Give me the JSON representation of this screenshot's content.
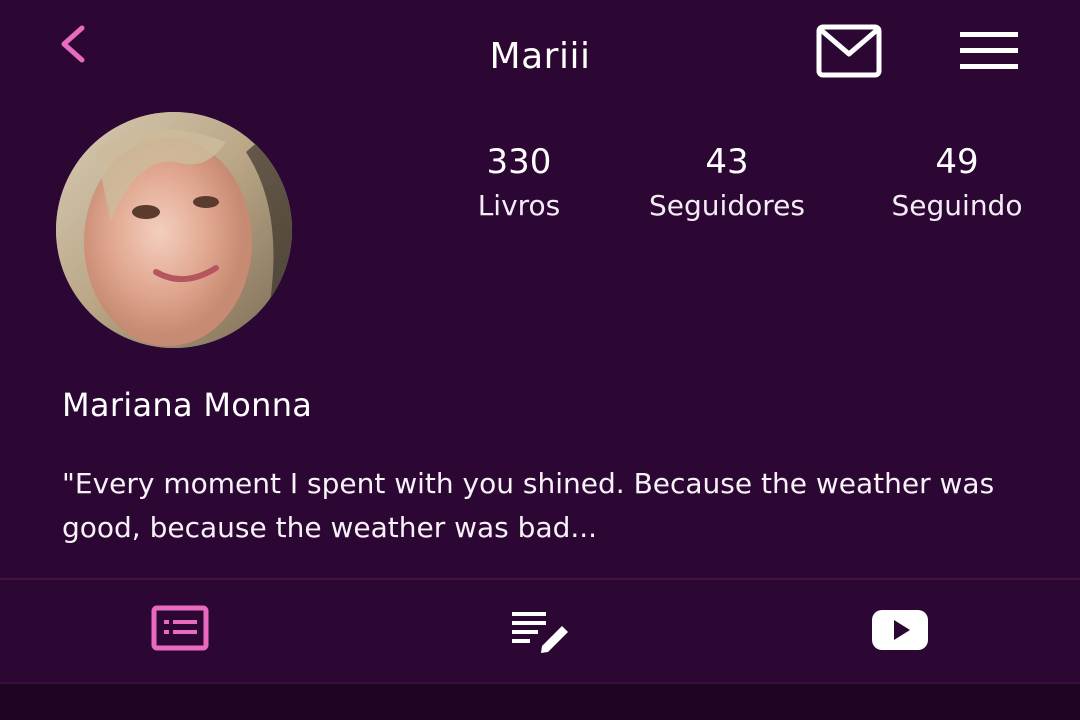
{
  "header": {
    "title": "Mariii",
    "back_icon": "chevron-left-icon",
    "mail_icon": "mail-icon",
    "menu_icon": "hamburger-menu-icon"
  },
  "profile": {
    "name": "Mariana Monna",
    "bio": "\"Every moment I spent with you shined. Because the weather was good, because the weather was bad..."
  },
  "stats": {
    "books": {
      "value": "330",
      "label": "Livros"
    },
    "followers": {
      "value": "43",
      "label": "Seguidores"
    },
    "following": {
      "value": "49",
      "label": "Seguindo"
    }
  },
  "tabs": [
    {
      "icon": "profile-card-icon",
      "active": true
    },
    {
      "icon": "edit-list-icon",
      "active": false
    },
    {
      "icon": "video-play-icon",
      "active": false
    }
  ],
  "colors": {
    "background": "#2d0734",
    "accent": "#e86bc0",
    "text": "#ffffff"
  }
}
